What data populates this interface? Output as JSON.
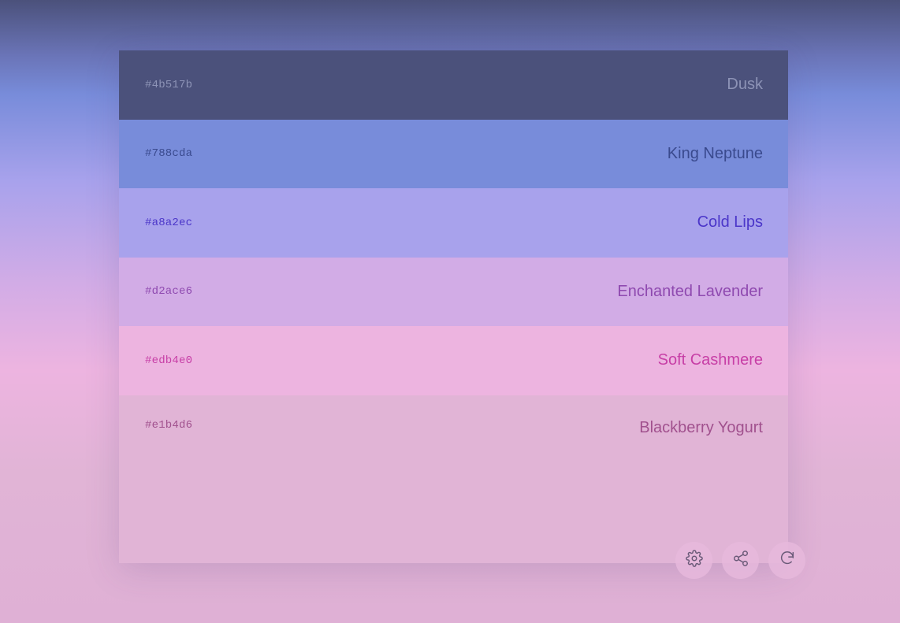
{
  "palette": {
    "swatches": [
      {
        "hex": "#4b517b",
        "name": "Dusk",
        "bg": "#4b517b",
        "text_color": "#8d93b6"
      },
      {
        "hex": "#788cda",
        "name": "King Neptune",
        "bg": "#788cda",
        "text_color": "#3a4a8e"
      },
      {
        "hex": "#a8a2ec",
        "name": "Cold Lips",
        "bg": "#a8a2ec",
        "text_color": "#4b36c9"
      },
      {
        "hex": "#d2ace6",
        "name": "Enchanted Lavender",
        "bg": "#d2ace6",
        "text_color": "#8f4ab0"
      },
      {
        "hex": "#edb4e0",
        "name": "Soft Cashmere",
        "bg": "#edb4e0",
        "text_color": "#c73fa6"
      },
      {
        "hex": "#e1b4d6",
        "name": "Blackberry Yogurt",
        "bg": "#e1b4d6",
        "text_color": "#a1518e"
      }
    ]
  },
  "controls": {
    "settings_icon": "gear-icon",
    "share_icon": "share-icon",
    "refresh_icon": "refresh-icon"
  }
}
